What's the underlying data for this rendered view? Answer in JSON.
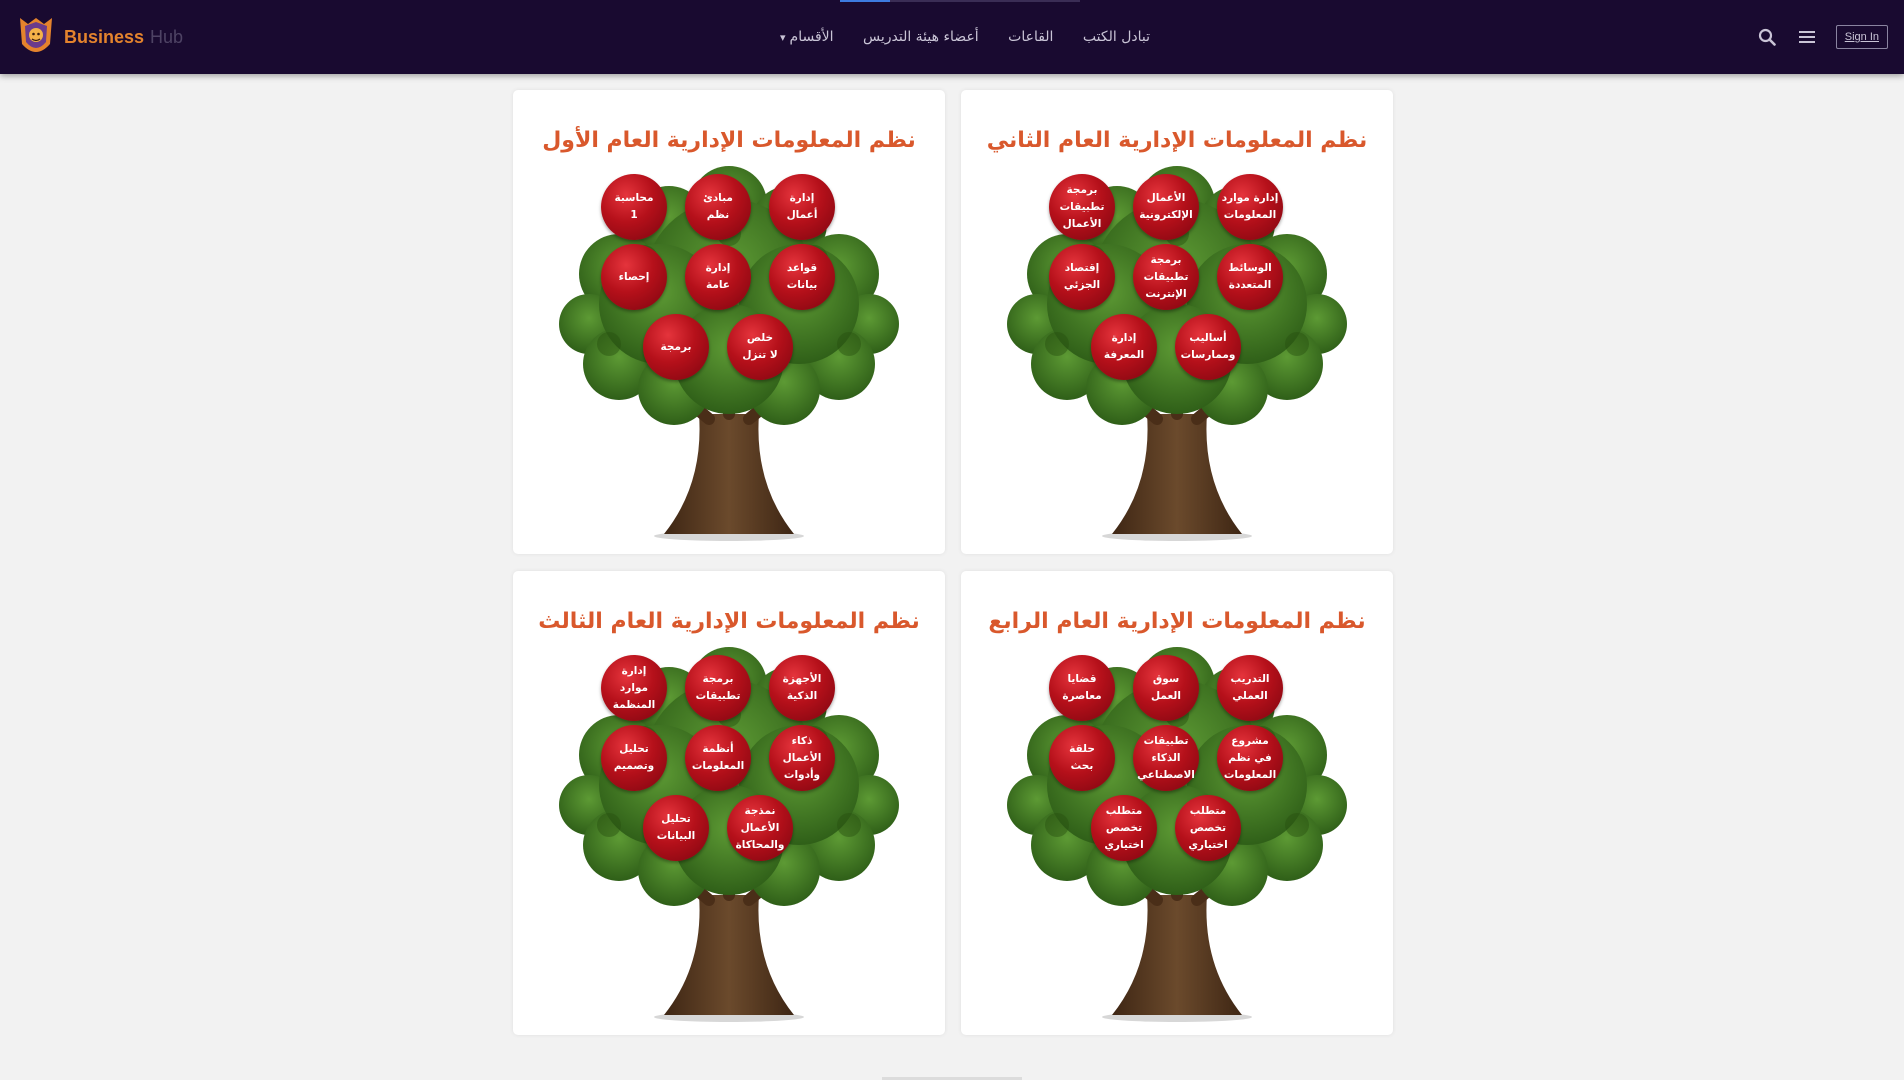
{
  "brand": {
    "name": "Business",
    "suffix": "Hub"
  },
  "nav": {
    "links": [
      {
        "label": "الأقسام",
        "has_dropdown": true
      },
      {
        "label": "أعضاء هيئة التدريس"
      },
      {
        "label": "القاعات"
      },
      {
        "label": "تبادل الكتب"
      }
    ],
    "search_icon": "search-icon",
    "menu_icon": "hamburger-menu-icon",
    "signin": "Sign In"
  },
  "cards": [
    {
      "title": "نظم المعلومات الإدارية العام الثاني",
      "fruits": [
        "إدارة موارد\nالمعلومات",
        "الأعمال\nالإلكترونية",
        "برمجة\nتطبيقات\nالأعمال",
        "الوسائط\nالمتعددة",
        "برمجة\nتطبيقات\nالإنترنت",
        "إقتصاد\nالجزئي",
        "أساليب\nوممارسات",
        "إدارة\nالمعرفة"
      ]
    },
    {
      "title": "نظم المعلومات الإدارية العام الأول",
      "fruits": [
        "إدارة\nأعمال",
        "مبادئ\nنظم",
        "محاسبة\n1",
        "قواعد\nبيانات",
        "إدارة\nعامة",
        "إحصاء",
        "خلص\nلا تنزل",
        "برمجة"
      ]
    },
    {
      "title": "نظم المعلومات الإدارية العام الرابع",
      "fruits": [
        "التدريب\nالعملي",
        "سوق\nالعمل",
        "قضايا\nمعاصرة",
        "مشروع\nفي نظم\nالمعلومات",
        "تطبيقات\nالذكاء\nالاصطناعي",
        "حلقة\nبحث",
        "متطلب\nتخصص\nاختياري",
        "متطلب\nتخصص\nاختياري"
      ]
    },
    {
      "title": "نظم المعلومات الإدارية العام الثالث",
      "fruits": [
        "الأجهزة\nالذكية",
        "برمجة\nتطبيقات",
        "إدارة\nموارد\nالمنظمة",
        "ذكاء\nالأعمال\nوأدوات",
        "أنظمة\nالمعلومات",
        "تحليل\nوتصميم",
        "نمذجة\nالأعمال\nوالمحاكاة",
        "تحليل\nالبيانات"
      ]
    }
  ],
  "colors": {
    "navbar": "#190a30",
    "brand_accent": "#e4832d",
    "title": "#d9582c",
    "fruit": "#b5101a",
    "leaf": "#3f7a22",
    "trunk": "#5b3b22"
  }
}
